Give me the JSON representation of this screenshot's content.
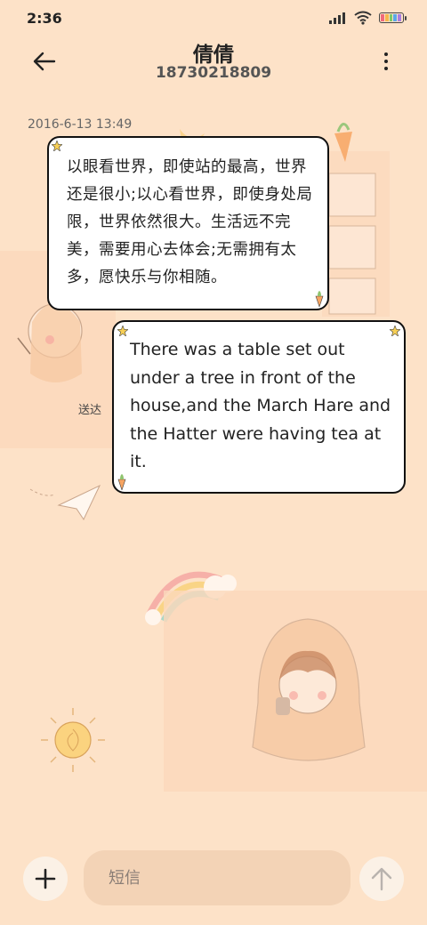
{
  "status_bar": {
    "time": "2:36"
  },
  "header": {
    "contact_name": "倩倩",
    "contact_number": "18730218809"
  },
  "conversation": {
    "timestamp": "2016-6-13 13:49",
    "messages": [
      {
        "text": "以眼看世界，即使站的最高，世界还是很小;以心看世界，即使身处局限，世界依然很大。生活远不完美，需要用心去体会;无需拥有太多，愿快乐与你相随。"
      },
      {
        "text": "There was a table set out under a tree in front of the house,and the March Hare and the Hatter were having tea at it."
      }
    ],
    "sent_status": "送达"
  },
  "composer": {
    "placeholder": "短信"
  },
  "icons": {
    "back": "arrow-left-icon",
    "more": "more-vertical-icon",
    "add": "plus-icon",
    "send": "arrow-up-icon"
  },
  "colors": {
    "background": "#fde2c8",
    "bubble": "#ffffff",
    "bubble_border": "#111111",
    "input_bg": "#f3d3b6"
  }
}
